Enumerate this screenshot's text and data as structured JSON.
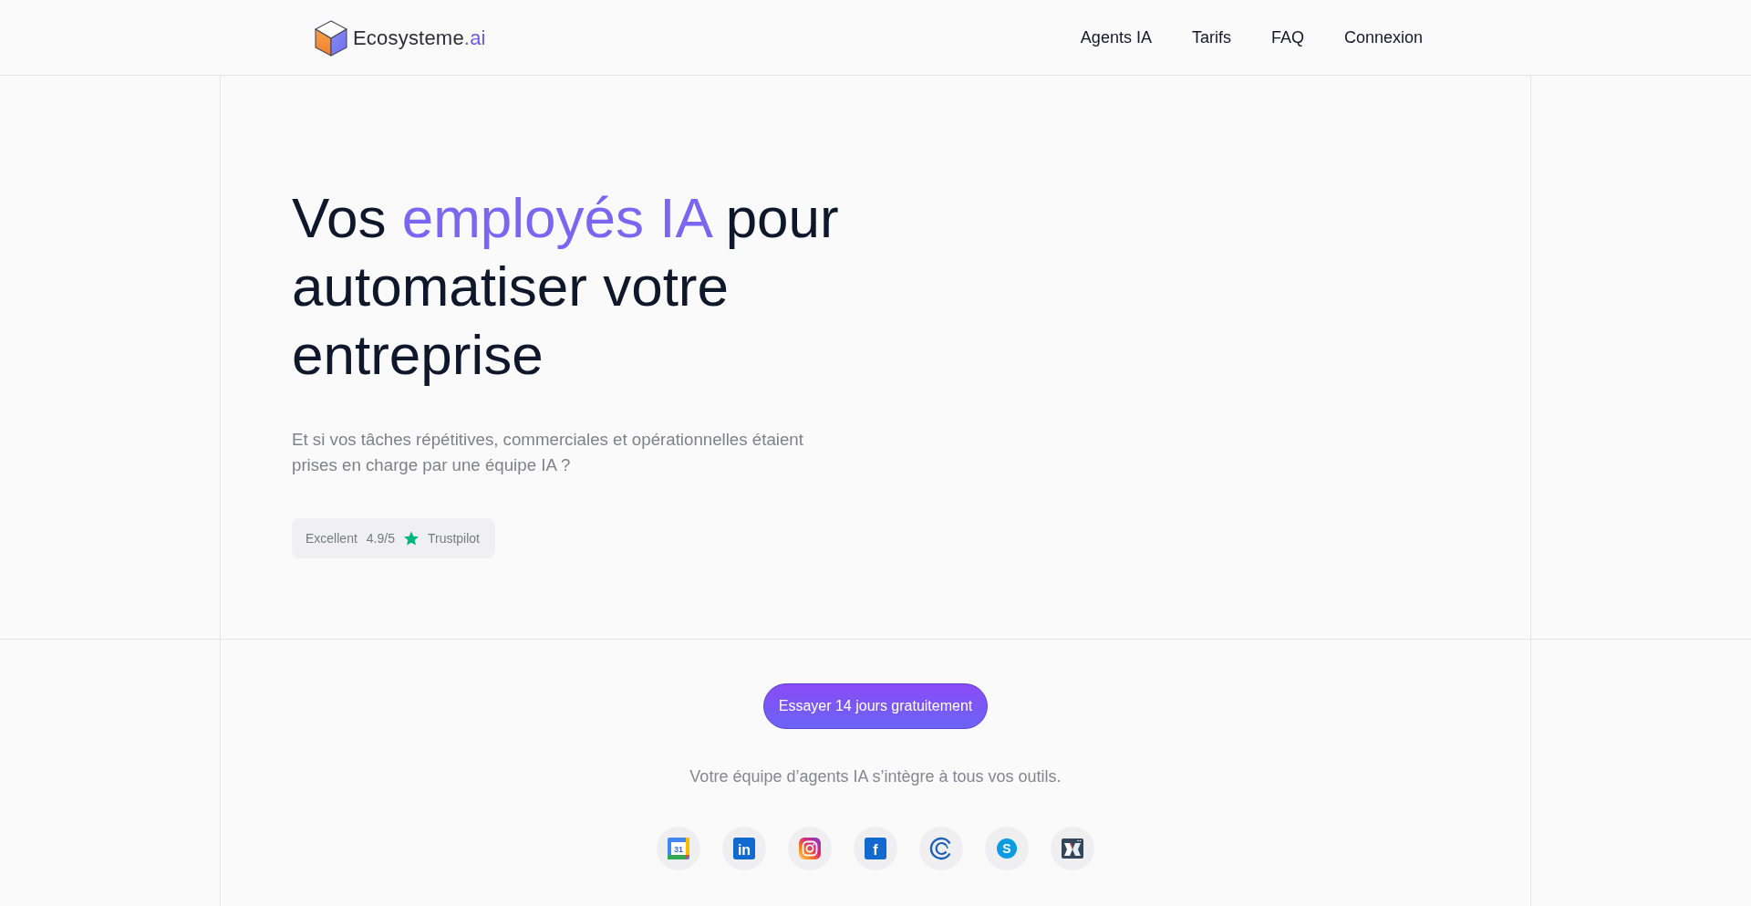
{
  "header": {
    "logo": {
      "name": "Ecosysteme",
      "suffix": ".ai"
    },
    "nav": [
      "Agents IA",
      "Tarifs",
      "FAQ",
      "Connexion"
    ]
  },
  "hero": {
    "heading": {
      "before": "Vos",
      "highlight": "employés IA",
      "after": "pour automatiser votre entreprise"
    },
    "subtitle": "Et si vos tâches répétitives, commerciales et opérationnelles étaient prises en charge par une équipe IA ?",
    "rating": {
      "label": "Excellent",
      "score": "4.9/5",
      "source": "Trustpilot"
    }
  },
  "cta": {
    "button": "Essayer 14 jours gratuitement",
    "caption": "Votre équipe d’agents IA s’intègre à tous vos outils.",
    "integrations": [
      {
        "kind": "calendar",
        "glyph": "31"
      },
      {
        "kind": "tile",
        "glyph": "in"
      },
      {
        "kind": "camera"
      },
      {
        "kind": "tile",
        "glyph": "f"
      },
      {
        "kind": "ring"
      },
      {
        "kind": "disc",
        "glyph": "S"
      },
      {
        "kind": "window"
      }
    ]
  }
}
